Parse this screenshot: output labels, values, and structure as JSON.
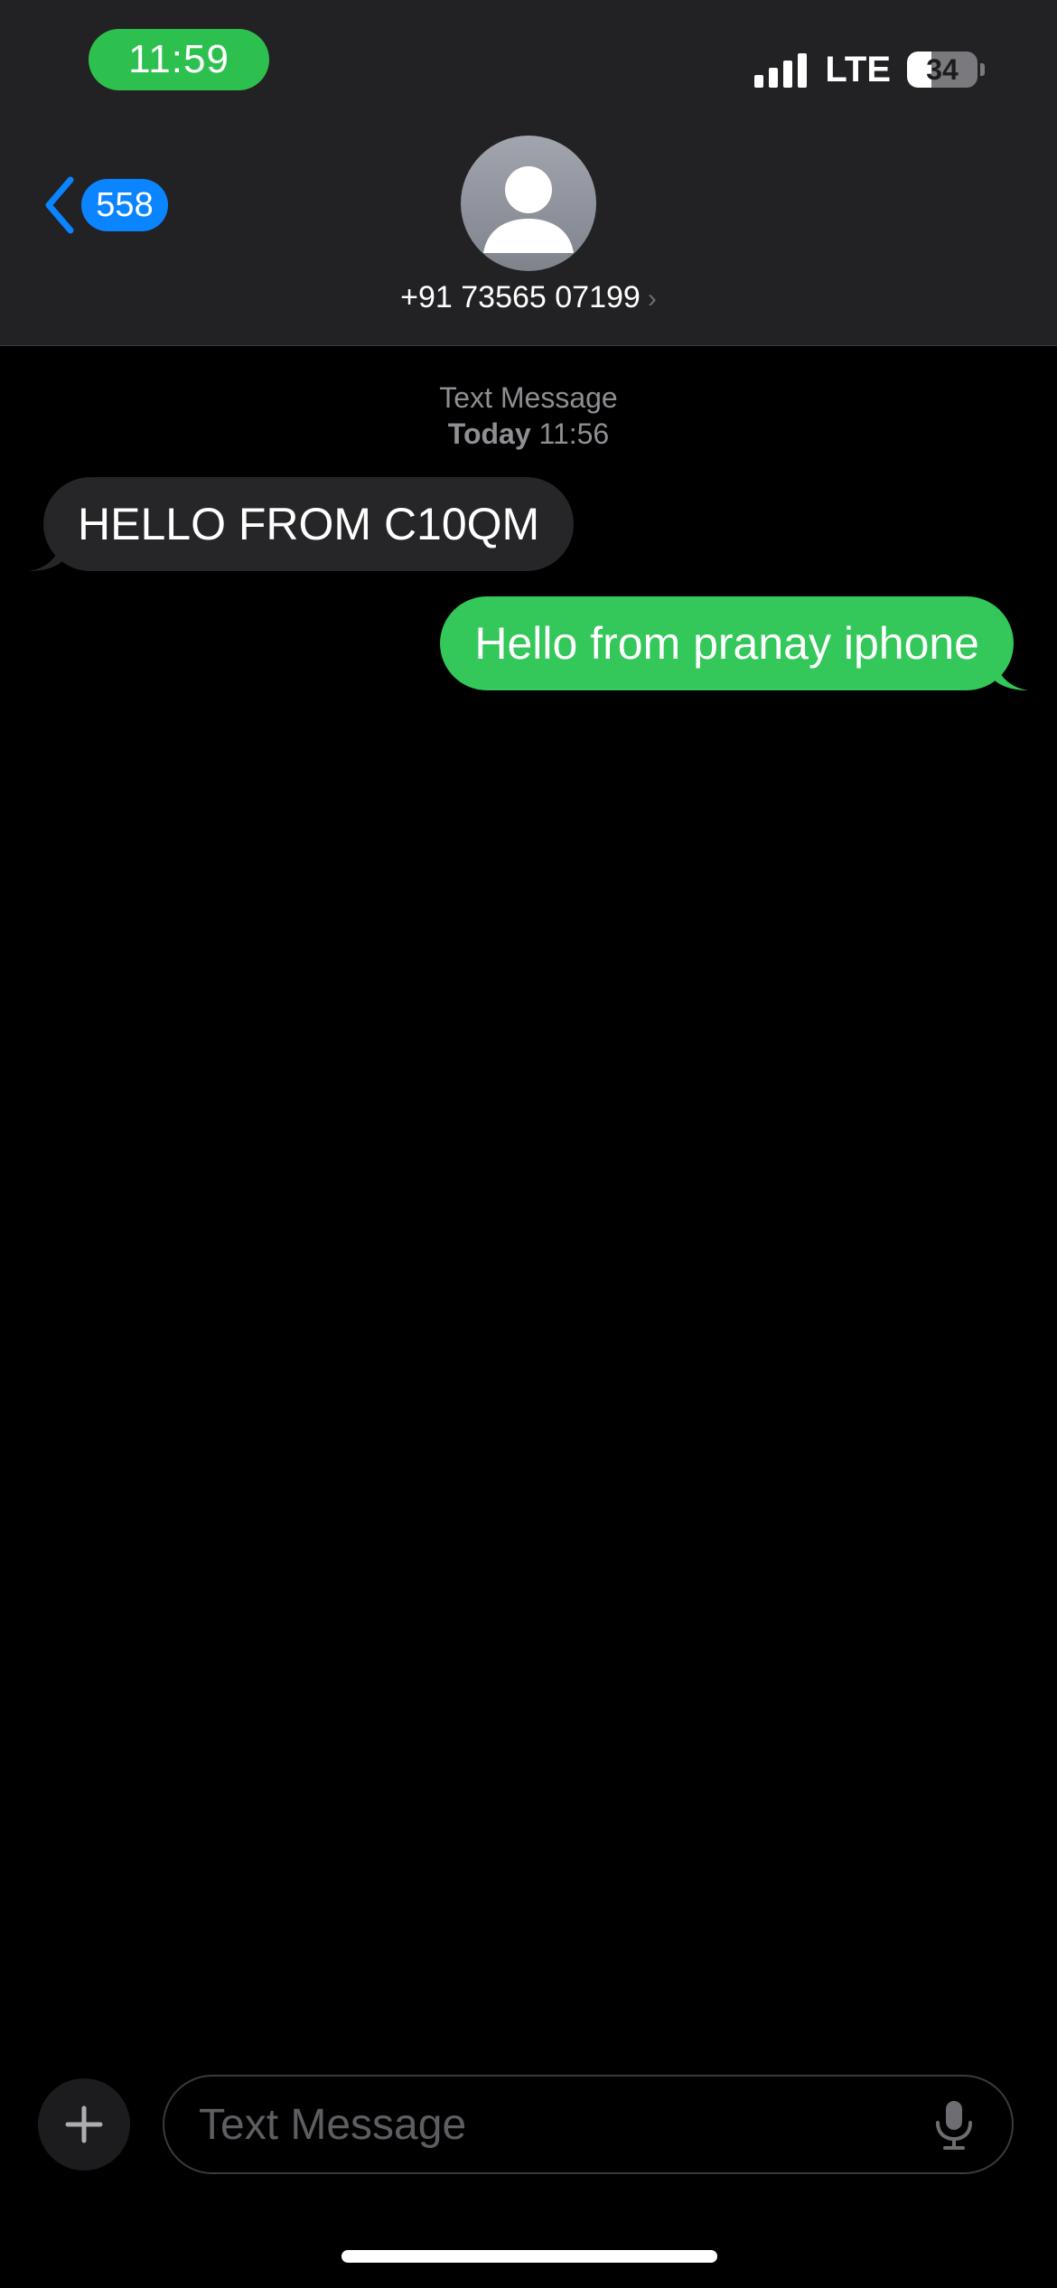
{
  "status_bar": {
    "time": "11:59",
    "network": "LTE",
    "battery_level": "34",
    "battery_fraction": 0.34,
    "signal_bars": 4
  },
  "header": {
    "back_badge": "558",
    "contact_name": "+91 73565 07199",
    "contact_chevron": "›"
  },
  "thread": {
    "service_label": "Text Message",
    "day": "Today",
    "time": "11:56"
  },
  "messages": [
    {
      "direction": "incoming",
      "text": "HELLO FROM C10QM"
    },
    {
      "direction": "outgoing",
      "text": "Hello from pranay iphone"
    }
  ],
  "compose": {
    "placeholder": "Text Message",
    "value": ""
  },
  "colors": {
    "header_bg": "#222224",
    "time_pill": "#2ec04f",
    "accent_blue": "#0a84ff",
    "outgoing_bubble": "#34c759",
    "incoming_bubble": "#262628"
  },
  "icons": {
    "back": "chevron-left-icon",
    "avatar": "person-placeholder-icon",
    "plus": "plus-icon",
    "mic": "microphone-icon",
    "signal": "cellular-signal-icon",
    "battery": "battery-icon"
  }
}
